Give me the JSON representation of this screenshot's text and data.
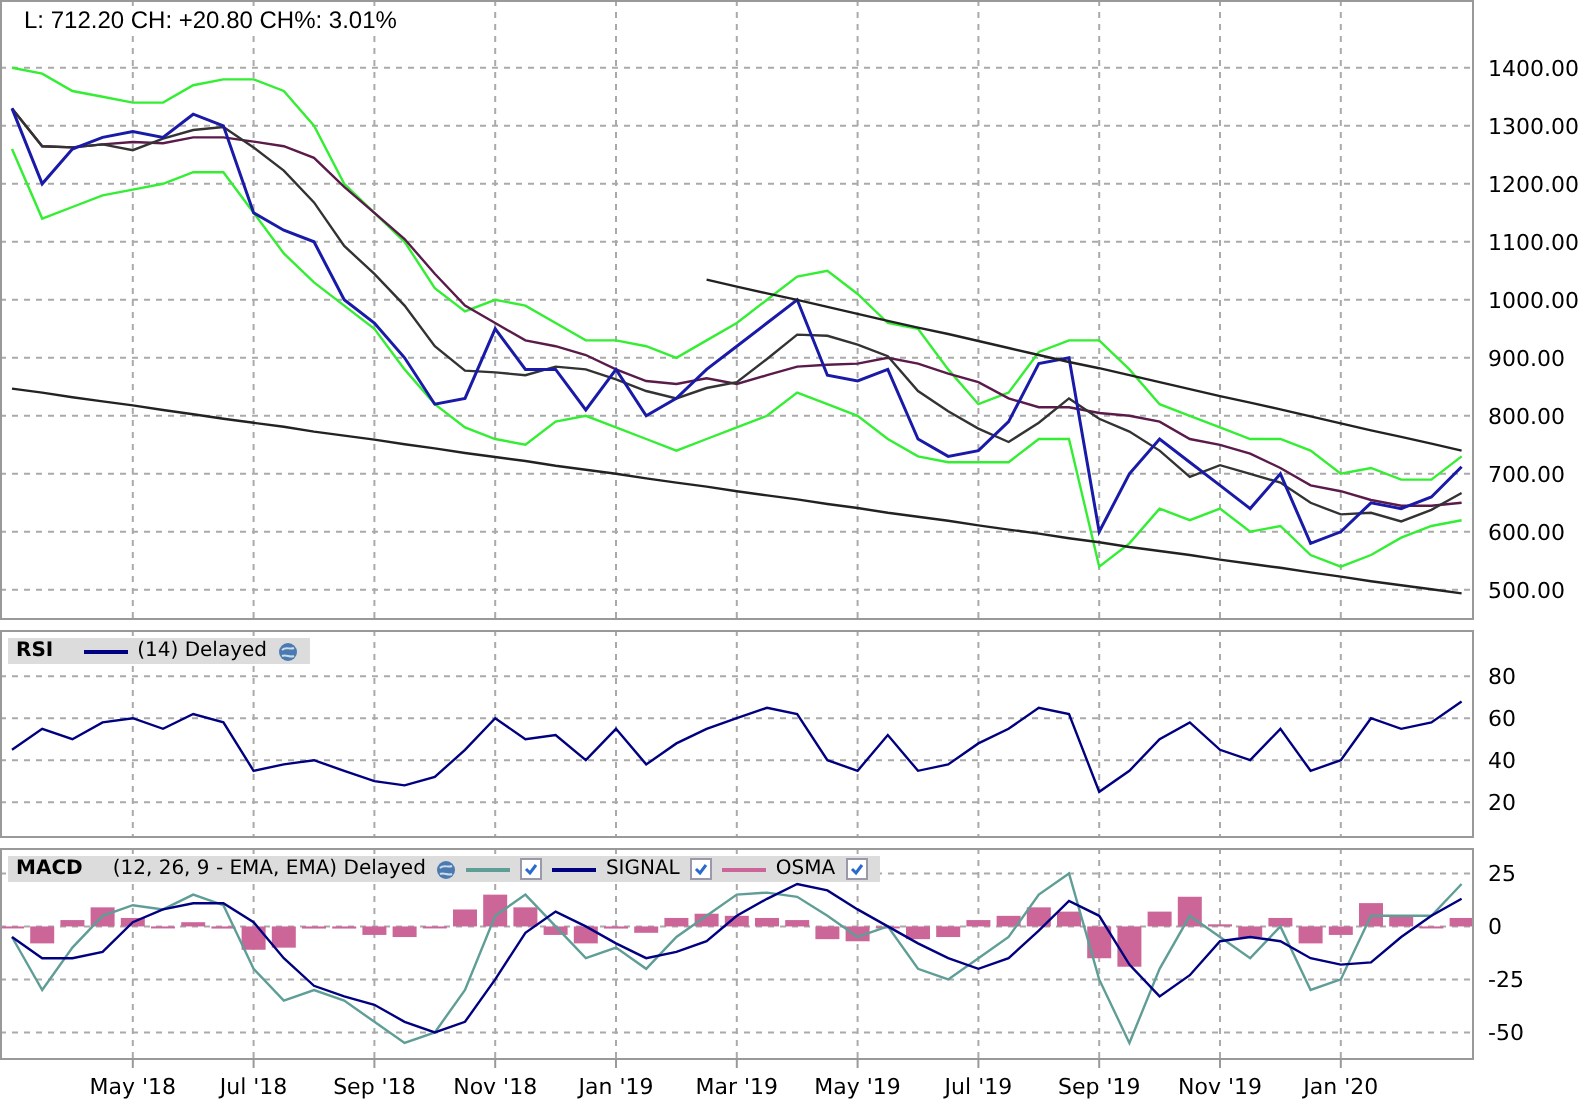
{
  "quote": {
    "text": "L: 712.20 CH: +20.80 CH%: 3.01%"
  },
  "price_panel": {
    "chart_data": {
      "type": "line",
      "grid": true,
      "ylim": [
        448,
        1517
      ],
      "yticks": [
        {
          "value": 500,
          "label": "500.00"
        },
        {
          "value": 600,
          "label": "600.00"
        },
        {
          "value": 700,
          "label": "700.00"
        },
        {
          "value": 800,
          "label": "800.00"
        },
        {
          "value": 900,
          "label": "900.00"
        },
        {
          "value": 1000,
          "label": "1000.00"
        },
        {
          "value": 1100,
          "label": "1100.00"
        },
        {
          "value": 1200,
          "label": "1200.00"
        },
        {
          "value": 1300,
          "label": "1300.00"
        },
        {
          "value": 1400,
          "label": "1400.00"
        }
      ],
      "series": [
        {
          "color": "#33ee33",
          "values": [
            1400,
            1390,
            1360,
            1350,
            1340,
            1340,
            1370,
            1380,
            1380,
            1360,
            1300,
            1200,
            1150,
            1100,
            1020,
            980,
            1000,
            990,
            960,
            930,
            930,
            920,
            900,
            930,
            960,
            1000,
            1040,
            1050,
            1010,
            960,
            950,
            880,
            820,
            840,
            910,
            930,
            930,
            880,
            820,
            800,
            780,
            760,
            760,
            740,
            700,
            710,
            690,
            690,
            730
          ]
        },
        {
          "color": "#33ee33",
          "values": [
            1260,
            1140,
            1160,
            1180,
            1190,
            1200,
            1220,
            1220,
            1150,
            1080,
            1030,
            990,
            950,
            880,
            820,
            780,
            760,
            750,
            790,
            800,
            780,
            760,
            740,
            760,
            780,
            800,
            840,
            820,
            800,
            760,
            730,
            720,
            720,
            720,
            760,
            760,
            540,
            580,
            640,
            620,
            640,
            600,
            610,
            560,
            540,
            560,
            590,
            610,
            620
          ]
        },
        {
          "color": "#5a1a4a",
          "values": [
            1330,
            1265,
            1263,
            1268,
            1272,
            1270,
            1280,
            1280,
            1273,
            1265,
            1245,
            1195,
            1150,
            1105,
            1045,
            990,
            960,
            930,
            920,
            905,
            880,
            860,
            855,
            865,
            855,
            870,
            885,
            888,
            890,
            900,
            890,
            873,
            858,
            830,
            815,
            815,
            805,
            800,
            790,
            760,
            750,
            735,
            710,
            680,
            670,
            655,
            645,
            645,
            650
          ]
        },
        {
          "color": "#333333",
          "values": [
            1330,
            1265,
            1263,
            1268,
            1258,
            1278,
            1293,
            1298,
            1263,
            1223,
            1168,
            1093,
            1045,
            990,
            920,
            878,
            875,
            870,
            885,
            880,
            863,
            843,
            830,
            848,
            858,
            898,
            940,
            938,
            923,
            903,
            843,
            808,
            778,
            755,
            788,
            830,
            795,
            773,
            740,
            695,
            715,
            700,
            685,
            650,
            630,
            633,
            618,
            638,
            667
          ]
        },
        {
          "color": "#1a1aa8",
          "values": [
            1330,
            1200,
            1260,
            1280,
            1290,
            1280,
            1320,
            1300,
            1150,
            1120,
            1100,
            1000,
            960,
            900,
            820,
            830,
            950,
            880,
            880,
            810,
            880,
            800,
            830,
            880,
            920,
            960,
            1000,
            870,
            860,
            880,
            760,
            730,
            740,
            790,
            890,
            900,
            600,
            700,
            760,
            720,
            680,
            640,
            700,
            580,
            600,
            650,
            640,
            660,
            712
          ]
        },
        {
          "color": "#222222",
          "values": [
            null,
            null,
            null,
            null,
            null,
            null,
            null,
            null,
            null,
            null,
            null,
            null,
            null,
            null,
            null,
            null,
            null,
            null,
            null,
            null,
            null,
            null,
            null,
            1035,
            1023,
            1011,
            1000,
            988,
            976,
            964,
            952,
            941,
            929,
            917,
            905,
            893,
            882,
            870,
            858,
            846,
            834,
            823,
            811,
            799,
            787,
            775,
            764,
            752,
            740
          ]
        },
        {
          "color": "#222222",
          "values": [
            847,
            840,
            832,
            825,
            818,
            810,
            803,
            795,
            788,
            781,
            773,
            766,
            759,
            751,
            744,
            736,
            729,
            722,
            714,
            707,
            700,
            692,
            685,
            678,
            670,
            663,
            656,
            648,
            641,
            633,
            626,
            619,
            611,
            604,
            597,
            589,
            582,
            574,
            567,
            560,
            552,
            545,
            538,
            530,
            523,
            515,
            508,
            501,
            494
          ]
        }
      ]
    }
  },
  "rsi_panel": {
    "legend": {
      "params": "(14) Delayed"
    },
    "chart_data": {
      "type": "line",
      "grid": true,
      "ylim": [
        3,
        102
      ],
      "yticks": [
        20,
        40,
        60,
        80
      ],
      "series": [
        {
          "name": "RSI",
          "color": "#000080",
          "values": [
            45,
            55,
            50,
            58,
            60,
            55,
            62,
            58,
            35,
            38,
            40,
            35,
            30,
            28,
            32,
            45,
            60,
            50,
            52,
            40,
            55,
            38,
            48,
            55,
            60,
            65,
            62,
            40,
            35,
            52,
            35,
            38,
            48,
            55,
            65,
            62,
            25,
            35,
            50,
            58,
            45,
            40,
            55,
            35,
            40,
            60,
            55,
            58,
            68
          ]
        }
      ]
    }
  },
  "macd_panel": {
    "legend": {
      "params": "(12, 26, 9 - EMA, EMA) Delayed",
      "items": [
        {
          "checked": true
        },
        {
          "checked": true
        },
        {
          "checked": true
        }
      ]
    },
    "chart_data": {
      "type": "line",
      "grid": true,
      "ylim": [
        -63,
        37
      ],
      "yticks": [
        -50,
        -25,
        0,
        25
      ],
      "categories": [
        null,
        null,
        null,
        null,
        "May '18",
        null,
        null,
        null,
        "Jul '18",
        null,
        null,
        null,
        "Sep '18",
        null,
        null,
        null,
        "Nov '18",
        null,
        null,
        null,
        "Jan '19",
        null,
        null,
        null,
        "Mar '19",
        null,
        null,
        null,
        "May '19",
        null,
        null,
        null,
        "Jul '19",
        null,
        null,
        null,
        "Sep '19",
        null,
        null,
        null,
        "Nov '19",
        null,
        null,
        null,
        "Jan '20",
        null,
        null,
        null,
        null
      ],
      "series": [
        {
          "name": "MACD",
          "color": "#5f9e96",
          "values": [
            -5,
            -30,
            -10,
            5,
            10,
            8,
            15,
            10,
            -20,
            -35,
            -30,
            -35,
            -45,
            -55,
            -50,
            -30,
            5,
            15,
            0,
            -15,
            -10,
            -20,
            -5,
            5,
            15,
            16,
            14,
            5,
            -5,
            0,
            -20,
            -25,
            -15,
            -5,
            15,
            25,
            -25,
            -55,
            -20,
            5,
            -5,
            -15,
            0,
            -30,
            -25,
            5,
            5,
            5,
            20
          ]
        },
        {
          "name": "SIGNAL",
          "color": "#000080",
          "values": [
            -5,
            -15,
            -15,
            -12,
            2,
            8,
            11,
            11,
            2,
            -15,
            -28,
            -33,
            -37,
            -45,
            -50,
            -45,
            -25,
            -3,
            7,
            0,
            -8,
            -15,
            -12,
            -7,
            5,
            13,
            20,
            17,
            8,
            0,
            -8,
            -15,
            -20,
            -15,
            -2,
            12,
            5,
            -18,
            -33,
            -23,
            -7,
            -5,
            -7,
            -15,
            -18,
            -17,
            -5,
            5,
            13
          ]
        },
        {
          "name": "OSMA",
          "type": "bar",
          "color": "#cc6699",
          "values": [
            0,
            -8,
            3,
            9,
            4,
            0,
            2,
            -1,
            -11,
            -10,
            -1,
            -1,
            -4,
            -5,
            0,
            8,
            15,
            9,
            -4,
            -8,
            -1,
            -3,
            4,
            6,
            5,
            4,
            3,
            -6,
            -7,
            0,
            -6,
            -5,
            3,
            5,
            9,
            7,
            -15,
            -19,
            7,
            14,
            1,
            -5,
            4,
            -8,
            -4,
            11,
            5,
            0,
            4
          ]
        }
      ]
    }
  }
}
